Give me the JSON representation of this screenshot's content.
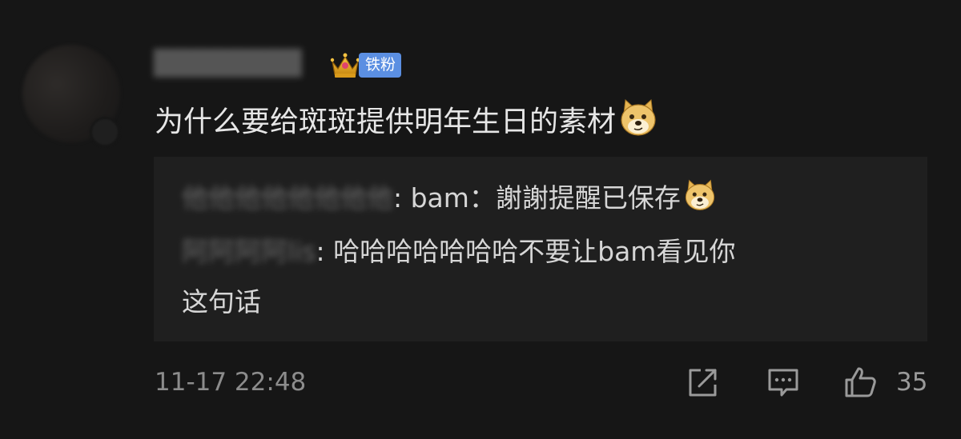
{
  "comment": {
    "author_badge": "铁粉",
    "text": "为什么要给斑斑提供明年生日的素材",
    "replies": [
      {
        "name": "他他他他他他他他",
        "separator": ": ",
        "text": "bam：謝謝提醒已保存"
      },
      {
        "name": "阿阿阿阿lis",
        "separator": ": ",
        "text": "哈哈哈哈哈哈哈不要让bam看见你",
        "text_cont": "这句话"
      }
    ],
    "timestamp": "11-17 22:48",
    "like_count": "35"
  },
  "icons": {
    "crown": "crown-icon",
    "doge": "doge-emoji-icon",
    "share": "share-icon",
    "comment": "comment-icon",
    "like": "thumbs-up-icon"
  },
  "colors": {
    "background": "#161616",
    "reply_background": "#1f1f1f",
    "badge_blue": "#5b8fe2",
    "text_primary": "#e6e6e6",
    "text_secondary": "#8c8c8c"
  }
}
